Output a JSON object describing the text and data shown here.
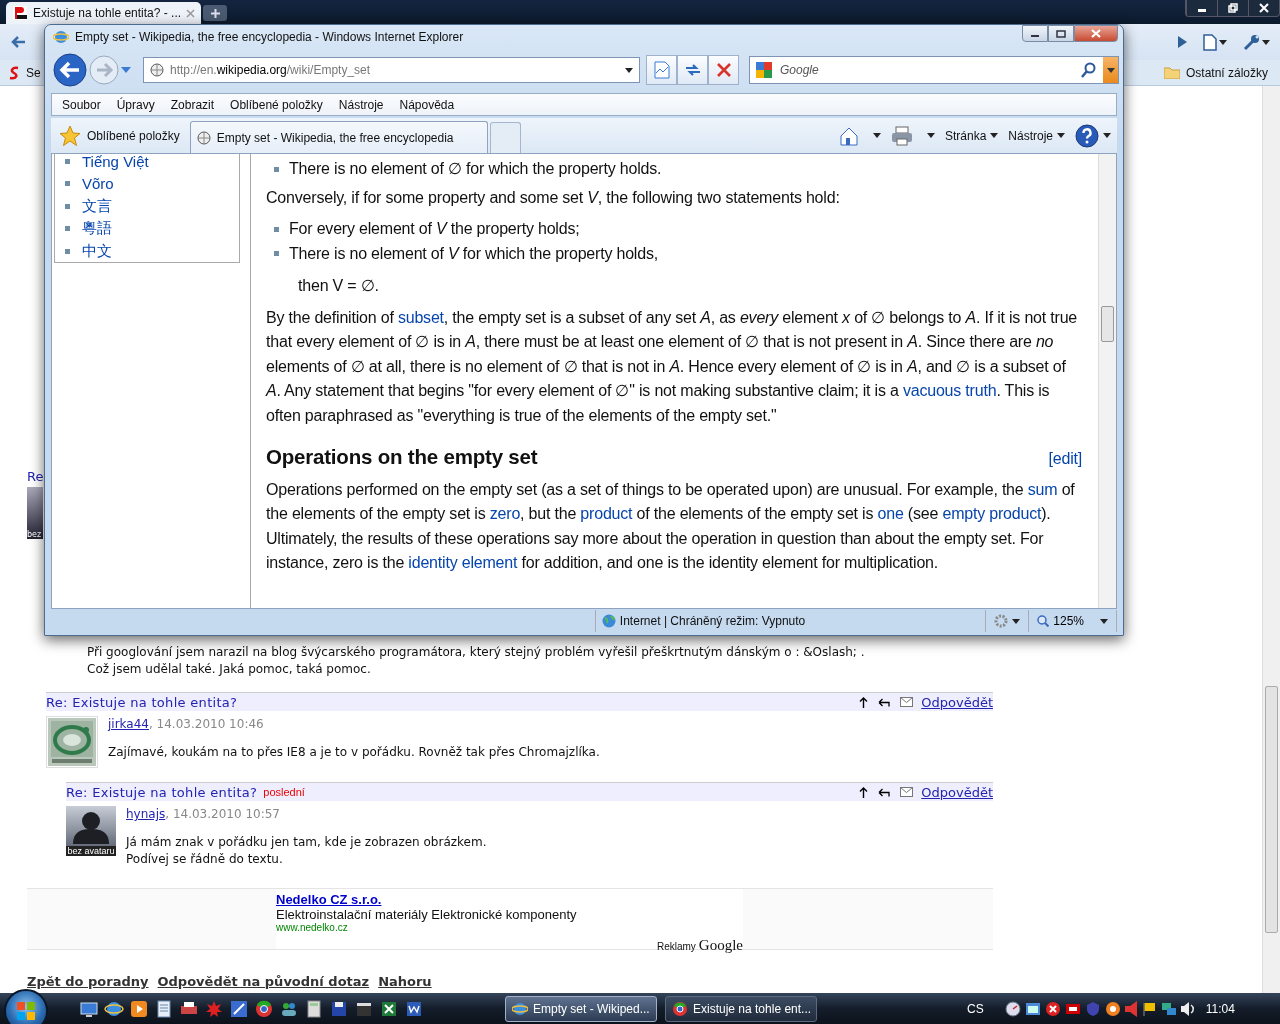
{
  "chrome": {
    "tab_title": "Existuje na tohle entita? - ...",
    "bookmark": "Se",
    "other_bookmarks": "Ostatní záložky",
    "page": {
      "hidden_heading": "Re",
      "avatar_caption_stub": "bez",
      "intro_lines": [
        "Při googlování jsem narazil na blog švýcarského programátora, který stejný problém vyřešil přeškrtnutým dánským o : &Oslash; .",
        "Což jsem udělal také. Jaká pomoc, taká pomoc."
      ],
      "comments": [
        {
          "title": "Re: Existuje na tohle entita?",
          "reply": "Odpovědět",
          "author": "jirka44",
          "date": ", 14.03.2010 10:46",
          "avatar": {
            "kind": "picture"
          },
          "lines": [
            "Zajímavé, koukám na to přes IE8 a je to v pořádku. Rovněž tak přes Chromajzlíka."
          ],
          "children": [
            {
              "title": "Re: Existuje na tohle entita?",
              "tag": "poslední",
              "reply": "Odpovědět",
              "author": "hynajs",
              "date": ", 14.03.2010 10:57",
              "avatar": {
                "kind": "placeholder",
                "caption": "bez avataru"
              },
              "lines": [
                "Já mám znak v pořádku jen tam, kde je zobrazen obrázkem.",
                "Podívej se řádně do textu."
              ]
            }
          ]
        }
      ],
      "ad": {
        "title": "Nedelko CZ s.r.o.",
        "text": "Elektroinstalační materiály Elektronické komponenty",
        "url": "www.nedelko.cz",
        "label": "Reklamy",
        "brand": "Google"
      },
      "footer_links": [
        "Zpět do poradny",
        "Odpovědět na původní dotaz",
        "Nahoru"
      ]
    }
  },
  "ie": {
    "title": "Empty set - Wikipedia, the free encyclopedia - Windows Internet Explorer",
    "address": "http://en.**wikipedia.org**/wiki/Empty_set",
    "search_placeholder": "Google",
    "menu": [
      "Soubor",
      "Úpravy",
      "Zobrazit",
      "Oblíbené položky",
      "Nástroje",
      "Nápověda"
    ],
    "favorites": "Oblíbené položky",
    "tabs": [
      {
        "label": "Empty set - Wikipedia, the free encyclopedia",
        "selected": true
      }
    ],
    "commands": [
      "Stránka",
      "Nástroje"
    ],
    "languages": [
      "Tiếng Việt",
      "Võro",
      "文言",
      "粵語",
      "中文"
    ],
    "article": [
      {
        "kind": "bullet",
        "parts": [
          {
            "text": "There is no element of ∅ for which the property holds."
          }
        ]
      },
      {
        "kind": "para",
        "parts": [
          {
            "text": "Conversely, if for some property and some set *V*, the following two statements hold:"
          }
        ]
      },
      {
        "kind": "bullet",
        "parts": [
          {
            "text": "For every element of *V* the property holds;"
          }
        ]
      },
      {
        "kind": "bullet",
        "parts": [
          {
            "text": "There is no element of *V* for which the property holds,"
          }
        ]
      },
      {
        "kind": "formula",
        "parts": [
          {
            "text": "then V = ∅."
          }
        ]
      },
      {
        "kind": "para",
        "parts": [
          {
            "text": "By the definition of "
          },
          {
            "link": "subset"
          },
          {
            "text": ", the empty set is a subset of any set *A*, as *every* element *x* of ∅ belongs to *A*. If it is not true that every element of ∅ is in *A*, there must be at least one element of ∅ that is not present in *A*. Since there are *no* elements of ∅ at all, there is no element of ∅ that is not in *A*. Hence every element of ∅ is in *A*, and ∅ is a subset of *A*. Any statement that begins \"for every element of ∅\" is not making substantive claim; it is a "
          },
          {
            "link": "vacuous truth"
          },
          {
            "text": ". This is often paraphrased as \"everything is true of the elements of the empty set.\""
          }
        ]
      },
      {
        "kind": "heading",
        "text": "Operations on the empty set",
        "edit": "[edit]"
      },
      {
        "kind": "para",
        "parts": [
          {
            "text": "Operations performed on the empty set (as a set of things to be operated upon) are unusual. For example, the "
          },
          {
            "link": "sum"
          },
          {
            "text": " of the elements of the empty set is "
          },
          {
            "link": "zero"
          },
          {
            "text": ", but the "
          },
          {
            "link": "product"
          },
          {
            "text": " of the elements of the empty set is "
          },
          {
            "link": "one"
          },
          {
            "text": " (see "
          },
          {
            "link": "empty product"
          },
          {
            "text": "). Ultimately, the results of these operations say more about the operation in question than about the empty set. For instance, zero is the "
          },
          {
            "link": "identity element"
          },
          {
            "text": " for addition, and one is the identity element for multiplication."
          }
        ]
      }
    ],
    "status": {
      "zone": "Internet | Chráněný režim: Vypnuto",
      "zoom": "125%"
    }
  },
  "taskbar": {
    "tasks": [
      {
        "label": "Empty set - Wikiped...",
        "selected": true
      },
      {
        "label": "Existuje na tohle ent...",
        "selected": false
      }
    ],
    "language": "CS",
    "clock": "11:04"
  }
}
